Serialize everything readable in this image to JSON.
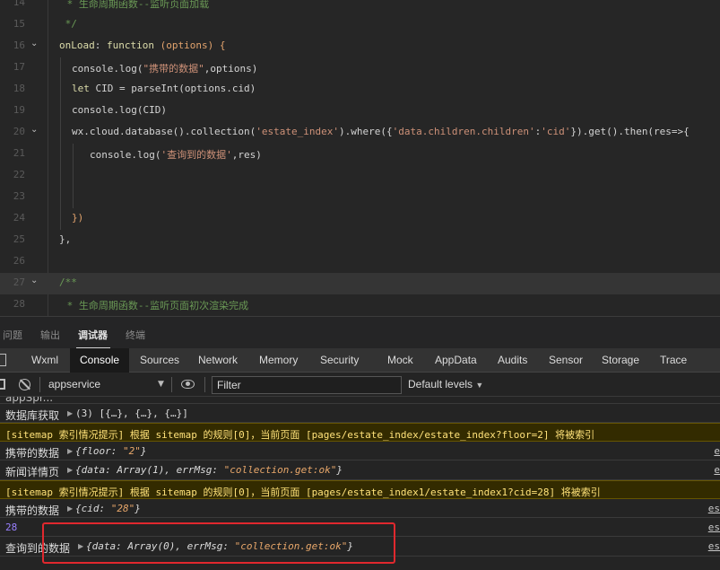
{
  "editor": {
    "lines": [
      {
        "num": "14",
        "prefix": " * ",
        "text": "生命周期函数--监听页面加载",
        "kind": "comment"
      },
      {
        "num": "15",
        "text": " */",
        "kind": "comment"
      },
      {
        "num": "16",
        "key": "onLoad",
        "sep": ": ",
        "kw": "function",
        "rest": " (options) {"
      },
      {
        "num": "17",
        "fn": "console.log(",
        "str": "\"携带的数据\"",
        "rest": ",options)"
      },
      {
        "num": "18",
        "kw": "let",
        "rest": " CID = parseInt(options.cid)"
      },
      {
        "num": "19",
        "text": "console.log(CID)"
      },
      {
        "num": "20",
        "pre": "wx.cloud.database().collection(",
        "str": "'estate_index'",
        "mid": ").where({",
        "str2": "'data.children.children'",
        "mid2": ":",
        "str3": "'cid'",
        "post": "}).get().then(res=>{"
      },
      {
        "num": "21",
        "fn": "console.log(",
        "str": "'查询到的数据'",
        "rest": ",res)"
      },
      {
        "num": "22",
        "text": ""
      },
      {
        "num": "23",
        "text": ""
      },
      {
        "num": "24",
        "text": "})"
      },
      {
        "num": "25",
        "text": "},"
      },
      {
        "num": "26",
        "text": ""
      },
      {
        "num": "27",
        "text": "/**",
        "kind": "comment"
      },
      {
        "num": "28",
        "prefix": " * ",
        "text": "生命周期函数--监听页面初次渲染完成",
        "kind": "comment"
      }
    ]
  },
  "panel_tabs": [
    {
      "label": "问题"
    },
    {
      "label": "输出"
    },
    {
      "label": "调试器",
      "active": true
    },
    {
      "label": "终端"
    }
  ],
  "devtools_tabs": [
    "Wxml",
    "Console",
    "Sources",
    "Network",
    "Memory",
    "Security",
    "Mock",
    "AppData",
    "Audits",
    "Sensor",
    "Storage",
    "Trace"
  ],
  "devtools_active": "Console",
  "toolbar": {
    "context": "appservice",
    "filter_placeholder": "Filter",
    "levels": "Default levels"
  },
  "console": {
    "clipped_top": "appSpr...",
    "rows": [
      {
        "label": "数据库获取",
        "value": "(3) [{…}, {…}, {…}]"
      },
      {
        "warn": "[sitemap 索引情况提示] 根据 sitemap 的规则[0]，当前页面 [pages/estate_index/estate_index?floor=2] 将被索引"
      },
      {
        "label": "携带的数据",
        "value": "{floor: \"2\"}",
        "src": "e"
      },
      {
        "label": "新闻详情页",
        "value": "{data: Array(1), errMsg: \"collection.get:ok\"}",
        "src": "e"
      },
      {
        "warn": "[sitemap 索引情况提示] 根据 sitemap 的规则[0]，当前页面 [pages/estate_index1/estate_index1?cid=28] 将被索引"
      },
      {
        "label": "携带的数据",
        "value": "{cid: \"28\"}",
        "src": "es"
      },
      {
        "num": "28",
        "src": "es"
      },
      {
        "label": "查询到的数据",
        "value": "{data: Array(0), errMsg: \"collection.get:ok\"}",
        "src": "es"
      }
    ]
  }
}
